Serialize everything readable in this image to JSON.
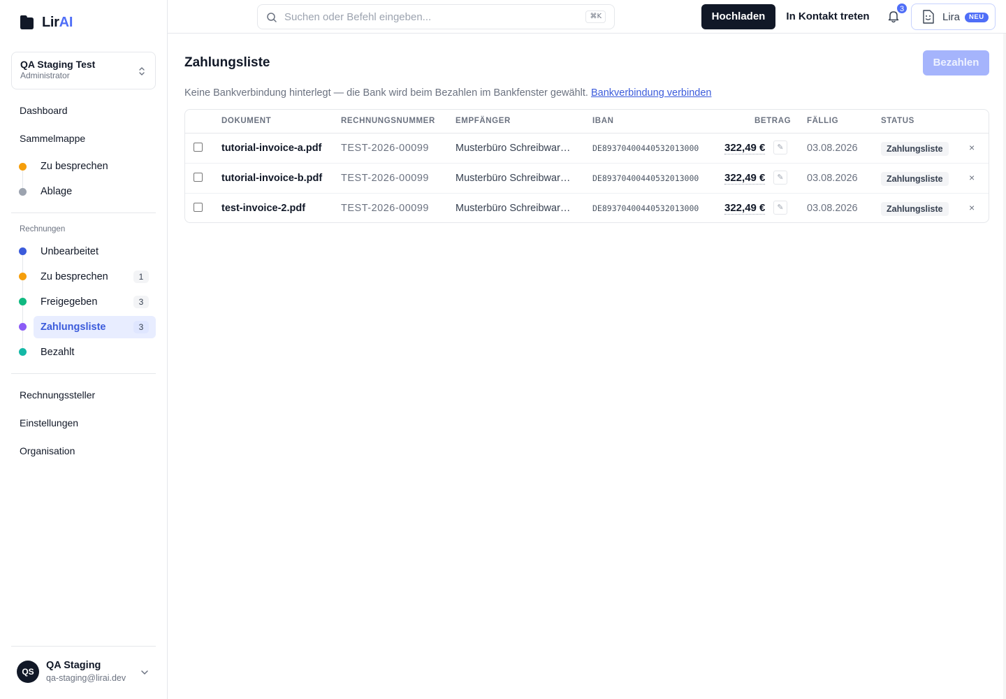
{
  "brand": {
    "name_part1": "Lir",
    "name_part2": "AI",
    "accent": "#4f6ef7"
  },
  "org": {
    "name": "QA Staging Test",
    "role": "Administrator"
  },
  "sidebar": {
    "dashboard": "Dashboard",
    "collection": "Sammelmappe",
    "collection_items": [
      {
        "label": "Zu besprechen",
        "color": "#f59e0b"
      },
      {
        "label": "Ablage",
        "color": "#9ca3af"
      }
    ],
    "invoices_section": "Rechnungen",
    "invoice_items": [
      {
        "label": "Unbearbeitet",
        "count": "",
        "color": "#3b5bdb"
      },
      {
        "label": "Zu besprechen",
        "count": "1",
        "color": "#f59e0b"
      },
      {
        "label": "Freigegeben",
        "count": "3",
        "color": "#10b981"
      },
      {
        "label": "Zahlungsliste",
        "count": "3",
        "color": "#8b5cf6"
      },
      {
        "label": "Bezahlt",
        "count": "",
        "color": "#14b8a6"
      }
    ],
    "issuers": "Rechnungssteller",
    "settings": "Einstellungen",
    "organisation": "Organisation"
  },
  "user": {
    "initials": "QS",
    "name": "QA Staging",
    "email": "qa-staging@lirai.dev"
  },
  "topbar": {
    "search_placeholder": "Suchen oder Befehl eingeben...",
    "search_shortcut": "⌘K",
    "upload": "Hochladen",
    "contact": "In Kontakt treten",
    "notifications_count": "3",
    "assistant": "Lira",
    "assistant_badge": "NEU"
  },
  "page": {
    "title": "Zahlungsliste",
    "pay_button": "Bezahlen",
    "bank_note": "Keine Bankverbindung hinterlegt — die Bank wird beim Bezahlen im Bankfenster gewählt.",
    "bank_link": "Bankverbindung verbinden"
  },
  "table": {
    "headers": {
      "document": "DOKUMENT",
      "number": "RECHNUNGSNUMMER",
      "recipient": "EMPFÄNGER",
      "iban": "IBAN",
      "amount": "BETRAG",
      "due": "FÄLLIG",
      "status": "STATUS"
    },
    "rows": [
      {
        "document": "tutorial-invoice-a.pdf",
        "number": "TEST-2026-00099",
        "recipient": "Musterbüro Schreibwaren GmbH",
        "iban": "DE89370400440532013000",
        "amount": "322,49 €",
        "due": "03.08.2026",
        "status": "Zahlungsliste"
      },
      {
        "document": "tutorial-invoice-b.pdf",
        "number": "TEST-2026-00099",
        "recipient": "Musterbüro Schreibwaren GmbH",
        "iban": "DE89370400440532013000",
        "amount": "322,49 €",
        "due": "03.08.2026",
        "status": "Zahlungsliste"
      },
      {
        "document": "test-invoice-2.pdf",
        "number": "TEST-2026-00099",
        "recipient": "Musterbüro Schreibwaren GmbH",
        "iban": "DE89370400440532013000",
        "amount": "322,49 €",
        "due": "03.08.2026",
        "status": "Zahlungsliste"
      }
    ]
  }
}
